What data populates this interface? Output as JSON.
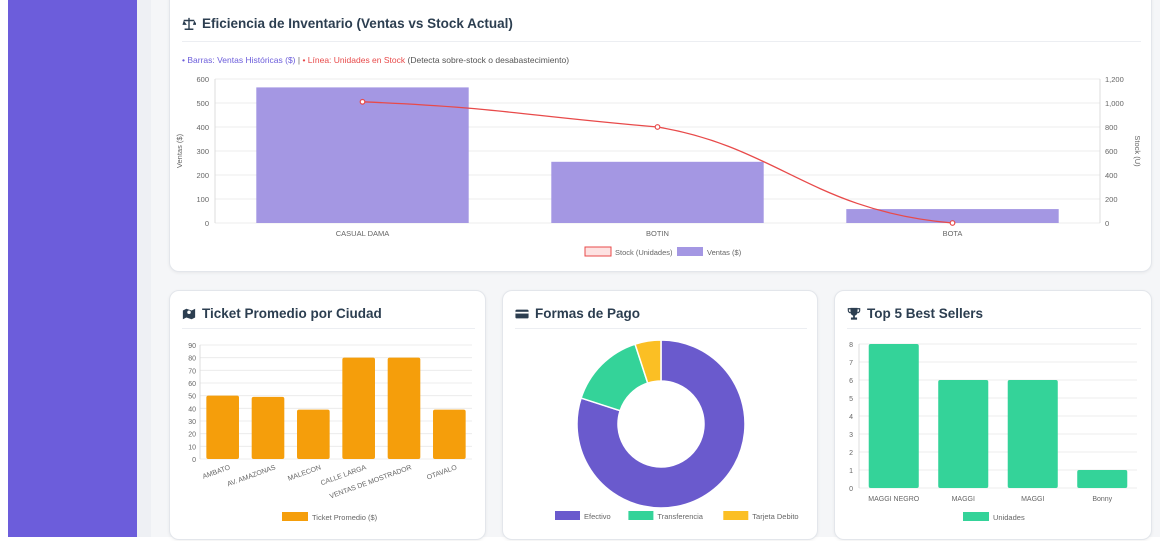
{
  "colors": {
    "sidebar": "#6c5ddb",
    "bar_purple": "#a497e3",
    "line_red": "#e84a4a",
    "orange": "#f59e0b",
    "green": "#34d399",
    "efectivo": "#6a5acd",
    "transferencia": "#34d399",
    "tarjeta": "#fbbf24"
  },
  "inventory": {
    "title": "Eficiencia de Inventario (Ventas vs Stock Actual)",
    "subtitle_bars": "• Barras: Ventas Históricas ($)",
    "subtitle_sep": " | ",
    "subtitle_line": "• Línea: Unidades en Stock",
    "subtitle_note": " (Detecta sobre-stock o desabastecimiento)",
    "icon": "scale-icon"
  },
  "ticket": {
    "title": "Ticket Promedio por Ciudad",
    "icon": "map-icon"
  },
  "payments": {
    "title": "Formas de Pago",
    "icon": "credit-card-icon"
  },
  "top5": {
    "title": "Top 5 Best Sellers",
    "icon": "trophy-icon"
  },
  "chart_data": [
    {
      "type": "bar",
      "categories": [
        "CASUAL DAMA",
        "BOTIN",
        "BOTA"
      ],
      "series": [
        {
          "name": "Ventas ($)",
          "type": "bar",
          "axis": "left",
          "values": [
            565,
            255,
            58
          ]
        },
        {
          "name": "Stock (Unidades)",
          "type": "line",
          "axis": "right",
          "values": [
            1010,
            800,
            0
          ]
        }
      ],
      "ylabel": "Ventas ($)",
      "y2label": "Stock (U)",
      "ylim": [
        0,
        600
      ],
      "y2lim": [
        0,
        1200
      ],
      "yticks": [
        "0",
        "100",
        "200",
        "300",
        "400",
        "500",
        "600"
      ],
      "y2ticks": [
        "0",
        "200",
        "400",
        "600",
        "800",
        "1,000",
        "1,200"
      ],
      "legend": "bottom",
      "grid": true
    },
    {
      "type": "bar",
      "categories": [
        "AMBATO",
        "AV. AMAZONAS",
        "MALECON",
        "CALLE LARGA",
        "VENTAS DE MOSTRADOR",
        "OTAVALO"
      ],
      "series": [
        {
          "name": "Ticket Promedio ($)",
          "values": [
            50,
            49,
            39,
            80,
            80,
            39
          ]
        }
      ],
      "ylim": [
        0,
        90
      ],
      "yticks": [
        "0",
        "10",
        "20",
        "30",
        "40",
        "50",
        "60",
        "70",
        "80",
        "90"
      ],
      "legend": "bottom",
      "grid": true
    },
    {
      "type": "pie",
      "categories": [
        "Efectivo",
        "Transferencia",
        "Tarjeta Debito"
      ],
      "values": [
        80,
        15,
        5
      ],
      "legend": "bottom"
    },
    {
      "type": "bar",
      "categories": [
        "MAGGI NEGRO",
        "MAGGI",
        "MAGGI",
        "Bonny"
      ],
      "series": [
        {
          "name": "Unidades",
          "values": [
            8,
            6,
            6,
            1
          ]
        }
      ],
      "ylim": [
        0,
        8
      ],
      "yticks": [
        "0",
        "1",
        "2",
        "3",
        "4",
        "5",
        "6",
        "7",
        "8"
      ],
      "legend": "bottom",
      "grid": true
    }
  ]
}
